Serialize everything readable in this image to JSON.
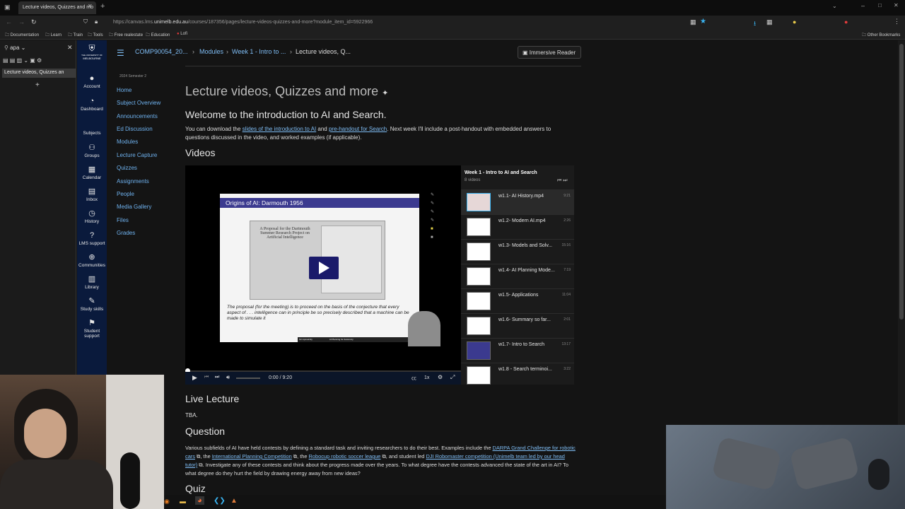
{
  "browser": {
    "tab_title": "Lecture videos, Quizzes and mo",
    "url_prefix": "https://canvas.lms.",
    "url_domain": "unimelb.edu.au",
    "url_rest": "/courses/187356/pages/lecture-videos-quizzes-and-more?module_item_id=5922966",
    "bookmarks": [
      "Documentation",
      "Learn",
      "Train",
      "Tools",
      "Free realestate",
      "Education",
      "Lofi"
    ],
    "other_bookmarks": "Other Bookmarks"
  },
  "sidetabs": {
    "search": "apa",
    "active_tab": "Lecture videos, Quizzes an"
  },
  "global_nav": {
    "logo_line1": "THE UNIVERSITY OF",
    "logo_line2": "MELBOURNE",
    "items": [
      "Account",
      "Dashboard",
      "Subjects",
      "Groups",
      "Calendar",
      "Inbox",
      "History",
      "LMS support",
      "Communities",
      "Library",
      "Study skills",
      "Student support"
    ]
  },
  "course_nav": {
    "term": "2024 Semester 2",
    "items": [
      "Home",
      "Subject Overview",
      "Announcements",
      "Ed Discussion",
      "Modules",
      "Lecture Capture",
      "Quizzes",
      "Assignments",
      "People",
      "Media Gallery",
      "Files",
      "Grades"
    ]
  },
  "breadcrumb": [
    "COMP90054_20...",
    "Modules",
    "Week 1 - Intro to ...",
    "Lecture videos, Q..."
  ],
  "immersive_reader": "Immersive Reader",
  "page": {
    "title": "Lecture videos, Quizzes and more",
    "welcome": "Welcome to the introduction to AI and Search.",
    "p1_a": "You can download the ",
    "p1_link1": "slides of the introduction to AI",
    "p1_b": " and ",
    "p1_link2": "pre-handout for Search",
    "p1_c": ". Next week I'll include a post-handout with embedded answers to questions discussed in the video, and worked examples (if applicable).",
    "videos_heading": "Videos",
    "live_heading": "Live Lecture",
    "live_text": "TBA.",
    "question_heading": "Question",
    "q_a": "Various subfields of AI have held contests by defining a standard task and inviting researchers to do their best. Examples include the ",
    "q_l1": "DARPA Grand Challenge for robotic cars",
    "q_b": ", the ",
    "q_l2": "International Planning Competition",
    "q_c": ", the ",
    "q_l3": "Robocup robotic soccer league",
    "q_d": ", and student led ",
    "q_l4": "DJI Robomaster competition (Unimelb team led by our head tutor)",
    "q_e": ". Investigate any of these contests and think about the progress made over the years. To what degree have the contests advanced the state of the art in AI? To what degree do they hurt the field by drawing energy away from new ideas?",
    "quiz_heading": "Quiz"
  },
  "player": {
    "slide_title": "Origins of AI: Darmouth 1956",
    "paper_title": "A Proposal for the Dartmouth Summer Research Project on Artificial Intelligence",
    "quote": "The proposal (for the meeting) is to proceed on the basis of the conjecture that every aspect of . . . intelligence can in principle be so precisely described that a machine can be made to simulate it",
    "footer_left": "Nir Lipovetzky",
    "footer_right": "AI Planning for Autonomy",
    "time": "0:00 / 9:20",
    "speed": "1x"
  },
  "playlist": {
    "title": "Week 1 - Intro to AI and Search",
    "count": "8 videos",
    "items": [
      {
        "title": "w1.1- AI History.mp4",
        "dur": "9:21"
      },
      {
        "title": "w1.2- Modern AI.mp4",
        "dur": "2:26"
      },
      {
        "title": "w1.3- Models and Solv...",
        "dur": "15:16"
      },
      {
        "title": "w1.4- AI Planning Mode...",
        "dur": "7:19"
      },
      {
        "title": "w1.5- Applications",
        "dur": "11:04"
      },
      {
        "title": "w1.6- Summary so far...",
        "dur": "2:01"
      },
      {
        "title": "w1.7- Intro to Search",
        "dur": "13:17"
      },
      {
        "title": "w1.8 - Search terminoi...",
        "dur": "3:22"
      }
    ]
  },
  "colors": {
    "link": "#7fbdf5",
    "global_nav_bg": "#0a1a3c",
    "slide_header": "#3b3a8f"
  }
}
